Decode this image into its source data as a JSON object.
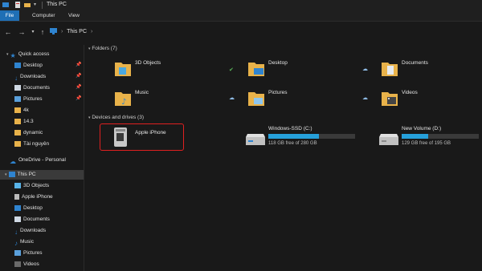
{
  "window": {
    "title": "This PC"
  },
  "ribbon": {
    "tabs": [
      "File",
      "Computer",
      "View"
    ]
  },
  "address": {
    "path": "This PC"
  },
  "sidebar": {
    "items": [
      {
        "label": "Quick access",
        "icon": "star-icon"
      },
      {
        "label": "Desktop",
        "icon": "desktop-icon"
      },
      {
        "label": "Downloads",
        "icon": "download-icon"
      },
      {
        "label": "Documents",
        "icon": "document-icon"
      },
      {
        "label": "Pictures",
        "icon": "picture-icon"
      },
      {
        "label": "4k",
        "icon": "folder-icon"
      },
      {
        "label": "14.3",
        "icon": "folder-icon"
      },
      {
        "label": "dynamic",
        "icon": "folder-icon"
      },
      {
        "label": "Tài nguyên",
        "icon": "folder-icon"
      },
      {
        "label": "OneDrive - Personal",
        "icon": "cloud-icon"
      },
      {
        "label": "This PC",
        "icon": "pc-icon"
      },
      {
        "label": "3D Objects",
        "icon": "cube-icon"
      },
      {
        "label": "Apple iPhone",
        "icon": "phone-icon"
      },
      {
        "label": "Desktop",
        "icon": "desktop-icon"
      },
      {
        "label": "Documents",
        "icon": "document-icon"
      },
      {
        "label": "Downloads",
        "icon": "download-icon"
      },
      {
        "label": "Music",
        "icon": "music-icon"
      },
      {
        "label": "Pictures",
        "icon": "picture-icon"
      },
      {
        "label": "Videos",
        "icon": "video-icon"
      }
    ]
  },
  "main": {
    "folders_header": "Folders (7)",
    "folders": [
      "3D Objects",
      "Desktop",
      "Documents",
      "Music",
      "Pictures",
      "Videos"
    ],
    "devices_header": "Devices and drives (3)",
    "devices": [
      {
        "name": "Apple iPhone"
      },
      {
        "name": "Windows-SSD (C:)",
        "free": "118 GB free of 280 GB",
        "used_fraction": 0.58
      },
      {
        "name": "New Volume (D:)",
        "free": "129 GB free of 195 GB",
        "used_fraction": 0.34
      }
    ]
  },
  "colors": {
    "accent": "#26a0da",
    "highlight": "#e02020",
    "folder": "#e8b24a"
  }
}
